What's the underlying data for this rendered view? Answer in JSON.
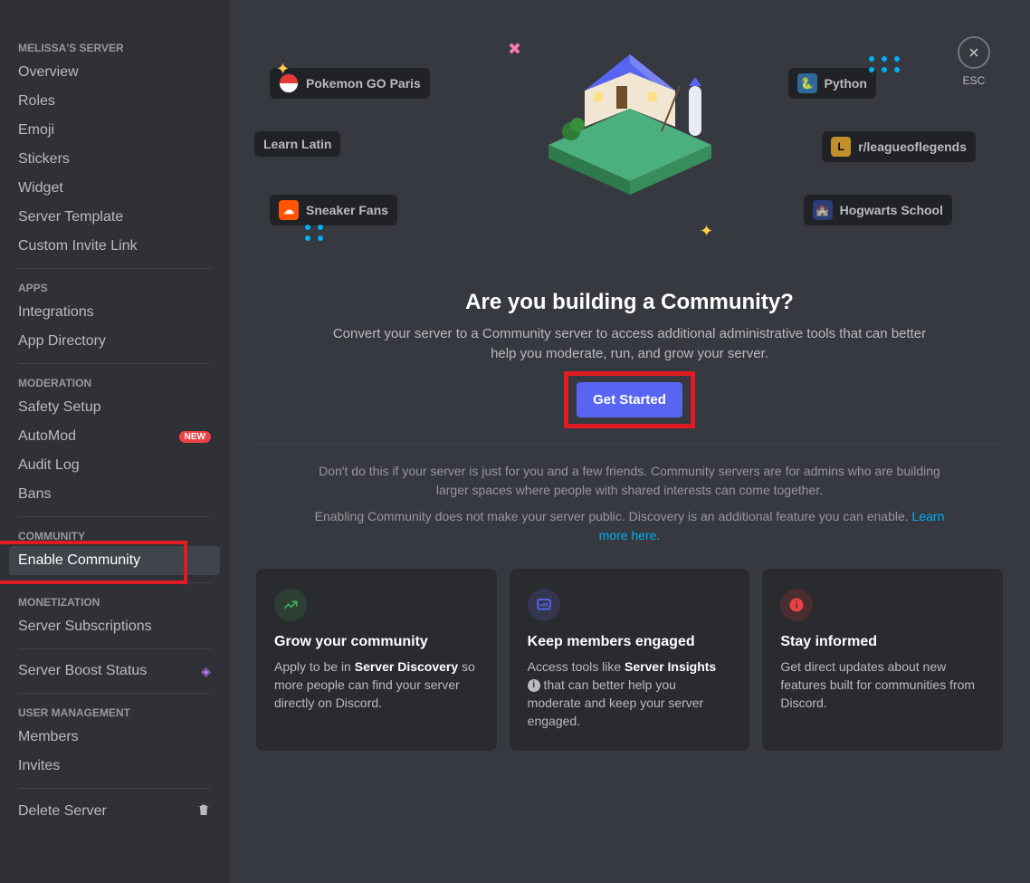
{
  "sidebar": {
    "server_name": "MELISSA'S SERVER",
    "items1": [
      {
        "label": "Overview"
      },
      {
        "label": "Roles"
      },
      {
        "label": "Emoji"
      },
      {
        "label": "Stickers"
      },
      {
        "label": "Widget"
      },
      {
        "label": "Server Template"
      },
      {
        "label": "Custom Invite Link"
      }
    ],
    "apps_header": "APPS",
    "items_apps": [
      {
        "label": "Integrations"
      },
      {
        "label": "App Directory"
      }
    ],
    "moderation_header": "MODERATION",
    "items_mod": [
      {
        "label": "Safety Setup"
      },
      {
        "label": "AutoMod",
        "badge": "NEW"
      },
      {
        "label": "Audit Log"
      },
      {
        "label": "Bans"
      }
    ],
    "community_header": "COMMUNITY",
    "items_comm": [
      {
        "label": "Enable Community",
        "active": true
      }
    ],
    "monetization_header": "MONETIZATION",
    "items_monet": [
      {
        "label": "Server Subscriptions"
      }
    ],
    "boost": {
      "label": "Server Boost Status"
    },
    "user_mgmt_header": "USER MANAGEMENT",
    "items_user": [
      {
        "label": "Members"
      },
      {
        "label": "Invites"
      }
    ],
    "delete": {
      "label": "Delete Server"
    }
  },
  "esc": {
    "label": "ESC"
  },
  "floating_servers": {
    "pokemon": "Pokemon GO Paris",
    "python": "Python",
    "learn_latin": "Learn Latin",
    "league": "r/leagueoflegends",
    "sneaker": "Sneaker Fans",
    "hogwarts": "Hogwarts School"
  },
  "hero": {
    "title": "Are you building a Community?",
    "subtitle": "Convert your server to a Community server to access additional administrative tools that can better help you moderate, run, and grow your server.",
    "cta": "Get Started"
  },
  "notes": {
    "line1": "Don't do this if your server is just for you and a few friends. Community servers are for admins who are building larger spaces where people with shared interests can come together.",
    "line2a": "Enabling Community does not make your server public. Discovery is an additional feature you can enable. ",
    "link": "Learn more here."
  },
  "cards": [
    {
      "title": "Grow your community",
      "text_pre": "Apply to be in ",
      "bold": "Server Discovery",
      "text_post": " so more people can find your server directly on Discord.",
      "icon": "trend-icon",
      "icon_color": "#3ba55d",
      "icon_bg": "#2d3f33"
    },
    {
      "title": "Keep members engaged",
      "text_pre": "Access tools like ",
      "bold": "Server Insights",
      "text_post": " that can better help you moderate and keep your server engaged.",
      "icon": "insights-icon",
      "icon_color": "#5865f2",
      "icon_bg": "#33364d",
      "info": true
    },
    {
      "title": "Stay informed",
      "text_pre": "Get direct updates about new features built for communities from Discord.",
      "bold": "",
      "text_post": "",
      "icon": "info-icon",
      "icon_color": "#ed4245",
      "icon_bg": "#4a2d2f"
    }
  ]
}
